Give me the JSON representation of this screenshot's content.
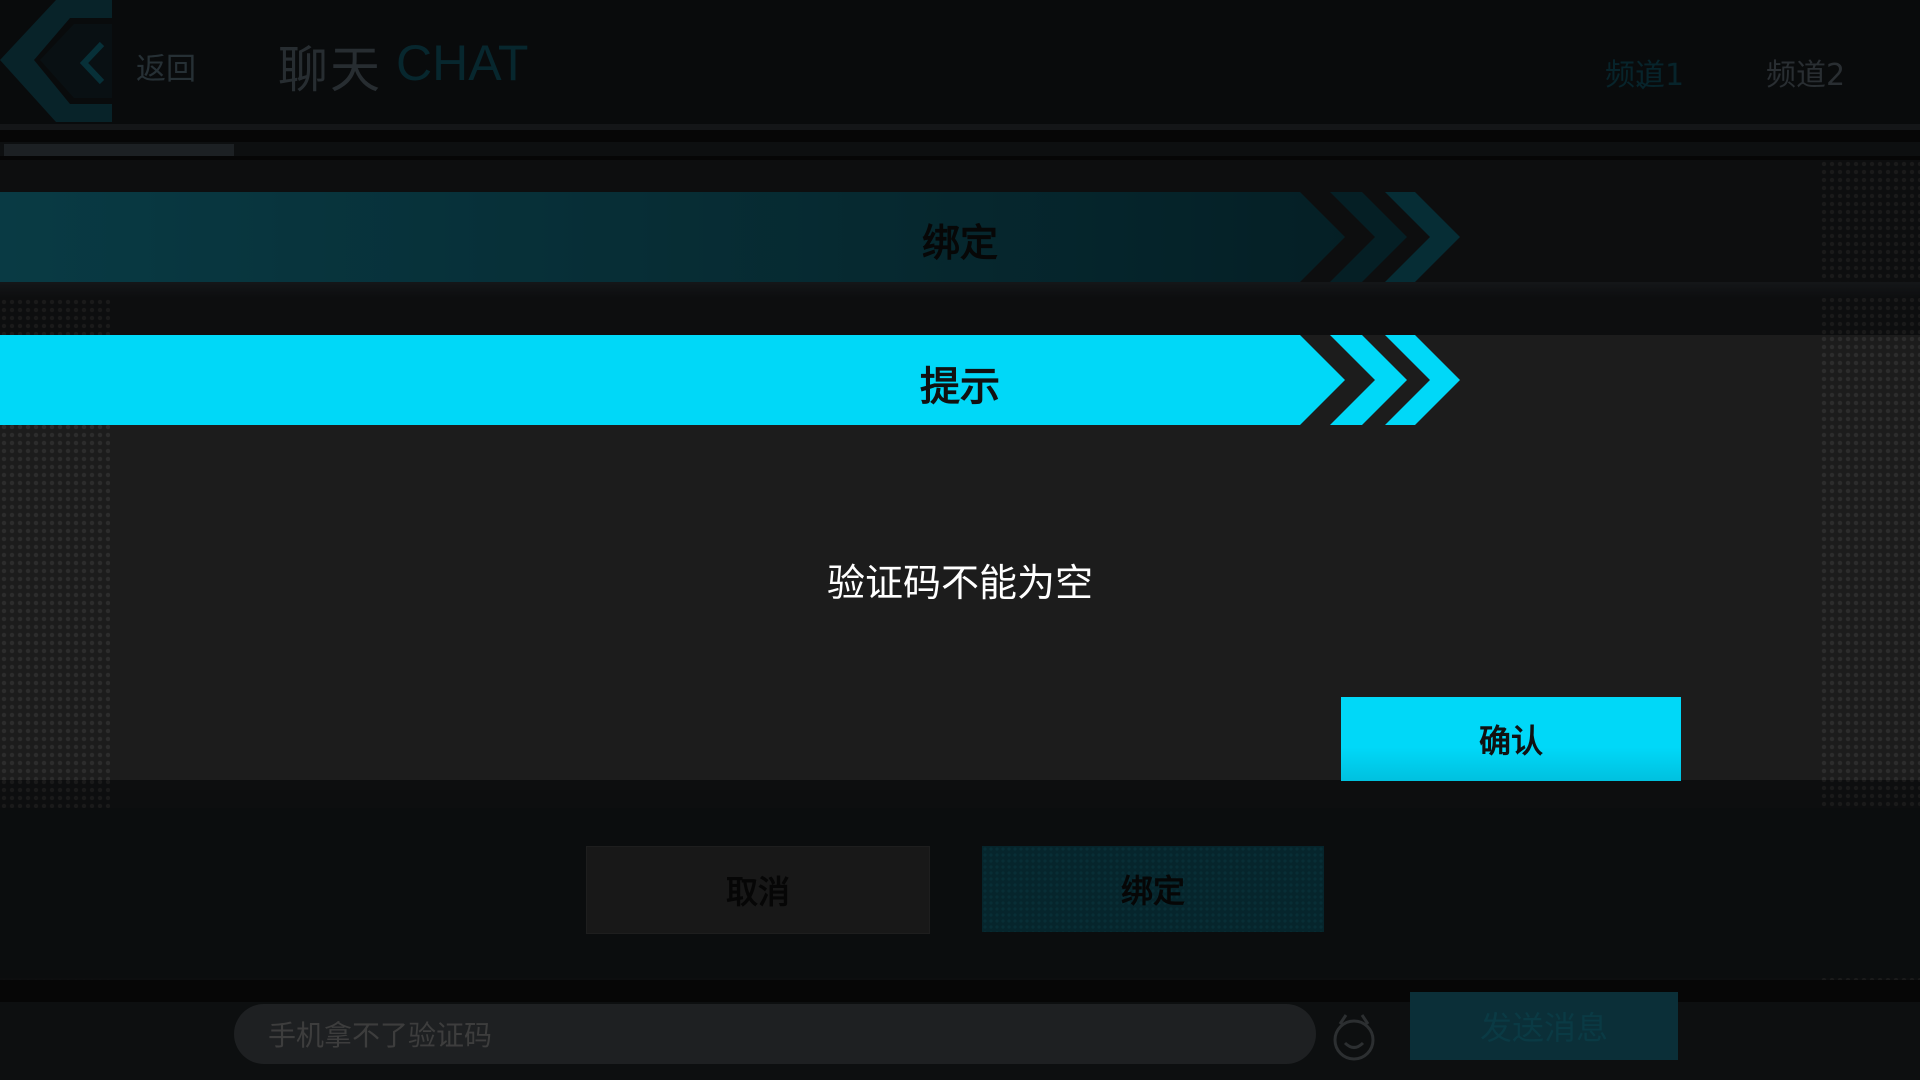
{
  "topbar": {
    "back_label": "返回",
    "title_cn": "聊天",
    "title_en": "CHAT",
    "tabs": [
      {
        "label": "频道1",
        "active": true
      },
      {
        "label": "频道2",
        "active": false
      }
    ]
  },
  "bind_dialog": {
    "title": "绑定",
    "cancel_label": "取消",
    "bind_label": "绑定"
  },
  "tip_dialog": {
    "title": "提示",
    "message": "验证码不能为空",
    "confirm_label": "确认"
  },
  "chat_input": {
    "value": "手机拿不了验证码",
    "send_label": "发送消息"
  },
  "colors": {
    "accent": "#00d8f8",
    "accent_dark": "#0b3d48",
    "panel": "#1c1c1c"
  }
}
